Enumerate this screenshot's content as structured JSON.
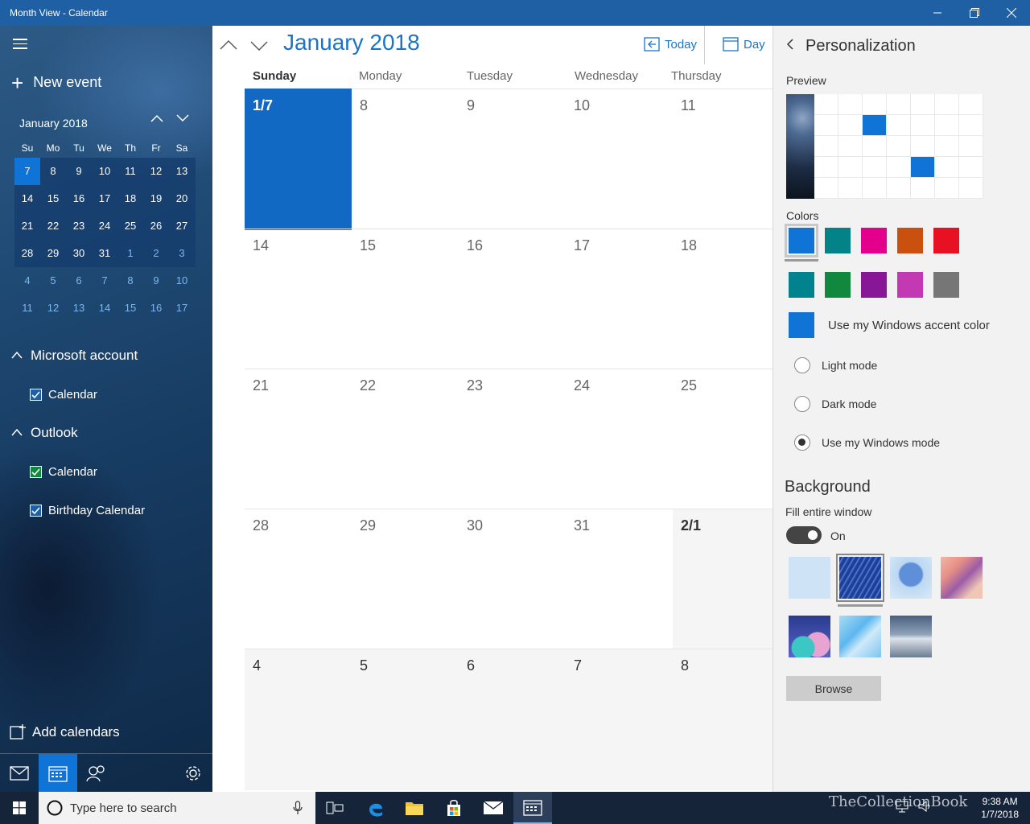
{
  "window": {
    "title": "Month View - Calendar"
  },
  "left": {
    "new_event": "New event",
    "mini": {
      "title": "January 2018",
      "dow": [
        "Su",
        "Mo",
        "Tu",
        "We",
        "Th",
        "Fr",
        "Sa"
      ],
      "weeks": [
        [
          "7",
          "8",
          "9",
          "10",
          "11",
          "12",
          "13"
        ],
        [
          "14",
          "15",
          "16",
          "17",
          "18",
          "19",
          "20"
        ],
        [
          "21",
          "22",
          "23",
          "24",
          "25",
          "26",
          "27"
        ],
        [
          "28",
          "29",
          "30",
          "31",
          "1",
          "2",
          "3"
        ],
        [
          "4",
          "5",
          "6",
          "7",
          "8",
          "9",
          "10"
        ],
        [
          "11",
          "12",
          "13",
          "14",
          "15",
          "16",
          "17"
        ]
      ]
    },
    "groups": [
      {
        "name": "Microsoft account",
        "calendars": [
          "Calendar"
        ]
      },
      {
        "name": "Outlook",
        "calendars": [
          "Calendar",
          "Birthday Calendar"
        ]
      }
    ],
    "add_calendars": "Add calendars"
  },
  "main": {
    "title": "January 2018",
    "today_label": "Today",
    "day_label": "Day",
    "weekdays": [
      "Sunday",
      "Monday",
      "Tuesday",
      "Wednesday",
      "Thursday"
    ],
    "weeks": [
      [
        "1/7",
        "8",
        "9",
        "10",
        "11"
      ],
      [
        "14",
        "15",
        "16",
        "17",
        "18"
      ],
      [
        "21",
        "22",
        "23",
        "24",
        "25"
      ],
      [
        "28",
        "29",
        "30",
        "31",
        "2/1"
      ],
      [
        "4",
        "5",
        "6",
        "7",
        "8"
      ]
    ]
  },
  "panel": {
    "title": "Personalization",
    "preview_label": "Preview",
    "colors_label": "Colors",
    "colors": [
      "#0f74d6",
      "#038387",
      "#e3008c",
      "#ca5010",
      "#e81123",
      "#00838f",
      "#10893e",
      "#881798",
      "#c239b3",
      "#767676"
    ],
    "accent_label": "Use my Windows accent color",
    "accent_color": "#0f74d6",
    "modes": [
      "Light mode",
      "Dark mode",
      "Use my Windows mode"
    ],
    "selected_mode": "Use my Windows mode",
    "background_title": "Background",
    "fill_label": "Fill entire window",
    "toggle_state": "On",
    "browse_label": "Browse"
  },
  "taskbar": {
    "search_placeholder": "Type here to search",
    "time": "9:38 AM",
    "date": "1/7/2018",
    "watermark": "TheCollectionBook"
  }
}
